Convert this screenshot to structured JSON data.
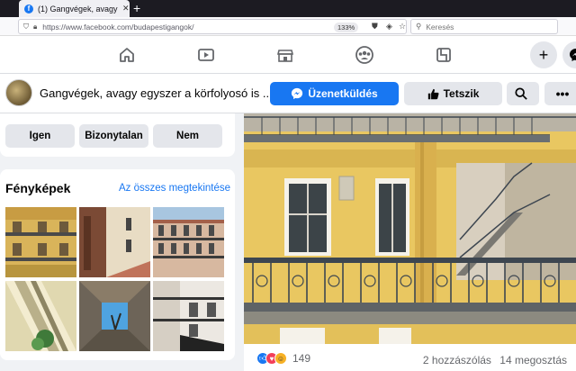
{
  "browser": {
    "tab_title": "(1) Gangvégek, avagy egyszer a",
    "url": "https://www.facebook.com/budapestigangok/",
    "zoom": "133%",
    "search_placeholder": "Keresés"
  },
  "page": {
    "name": "Gangvégek, avagy egyszer a körfolyosó is ...",
    "message_button": "Üzenetküldés",
    "like_button": "Tetszik"
  },
  "poll": {
    "options": [
      "Igen",
      "Bizonytalan",
      "Nem"
    ]
  },
  "photos_card": {
    "title": "Fényképek",
    "see_all": "Az összes megtekintése"
  },
  "post": {
    "reaction_count": "149",
    "comments": "2 hozzászólás",
    "shares": "14 megosztás"
  },
  "colors": {
    "facebook_blue": "#1877f2",
    "button_gray": "#e4e6eb",
    "background": "#f0f2f5"
  }
}
